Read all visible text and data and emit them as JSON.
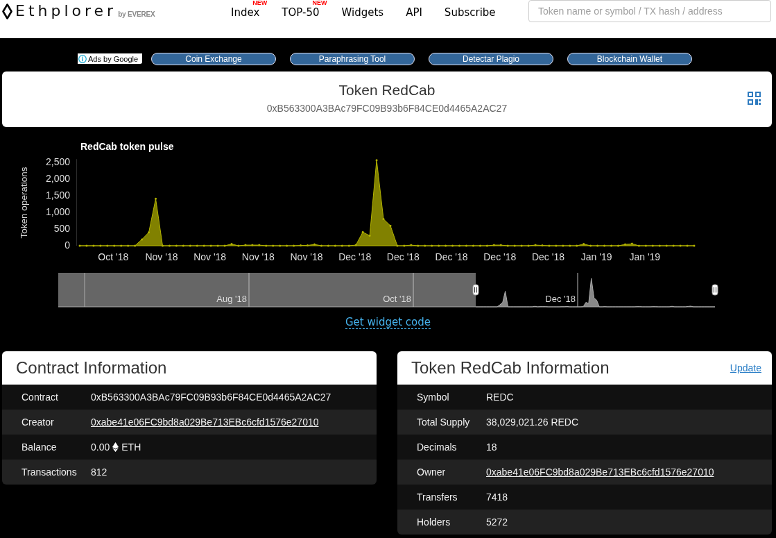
{
  "header": {
    "logo": {
      "wordmark": "Ethplorer",
      "byline": "by EVEREX"
    },
    "nav": [
      {
        "label": "Index",
        "badge": "NEW"
      },
      {
        "label": "TOP-50",
        "badge": "NEW"
      },
      {
        "label": "Widgets"
      },
      {
        "label": "API"
      },
      {
        "label": "Subscribe"
      }
    ],
    "search": {
      "placeholder": "Token name or symbol / TX hash / address"
    }
  },
  "ads": {
    "label": "Ads by Google",
    "links": [
      "Coin Exchange",
      "Paraphrasing Tool",
      "Detectar Plagio",
      "Blockchain Wallet"
    ]
  },
  "token_card": {
    "title": "Token RedCab",
    "address": "0xB563300A3BAc79FC09B93b6F84CE0d4465A2AC27"
  },
  "chart": {
    "chart_data": {
      "type": "area",
      "title": "RedCab token pulse",
      "ylabel": "Token operations",
      "categories": [
        null,
        null,
        null,
        null,
        null,
        "Oct '18",
        null,
        null,
        null,
        null,
        null,
        null,
        "Nov '18",
        null,
        null,
        null,
        null,
        null,
        null,
        "Nov '18",
        null,
        null,
        null,
        null,
        null,
        null,
        "Nov '18",
        null,
        null,
        null,
        null,
        null,
        null,
        "Nov '18",
        null,
        null,
        null,
        null,
        null,
        null,
        "Dec '18",
        null,
        null,
        null,
        null,
        null,
        null,
        "Dec '18",
        null,
        null,
        null,
        null,
        null,
        null,
        "Dec '18",
        null,
        null,
        null,
        null,
        null,
        null,
        "Dec '18",
        null,
        null,
        null,
        null,
        null,
        null,
        "Dec '18",
        null,
        null,
        null,
        null,
        null,
        null,
        "Jan '19",
        null,
        null,
        null,
        null,
        null,
        null,
        "Jan '19",
        null,
        null,
        null,
        null,
        null,
        null,
        null
      ],
      "series": [
        {
          "color": "#b3b300",
          "values": [
            0,
            0,
            0,
            0,
            0,
            0,
            0,
            0,
            0,
            190,
            400,
            1410,
            0,
            0,
            0,
            0,
            0,
            0,
            0,
            0,
            0,
            0,
            50,
            0,
            20,
            20,
            20,
            0,
            0,
            0,
            0,
            0,
            10,
            10,
            40,
            0,
            0,
            0,
            0,
            0,
            20,
            410,
            300,
            2570,
            800,
            600,
            0,
            0,
            20,
            0,
            0,
            0,
            0,
            0,
            0,
            0,
            0,
            0,
            0,
            0,
            20,
            20,
            0,
            0,
            0,
            0,
            20,
            10,
            0,
            0,
            0,
            0,
            0,
            50,
            0,
            0,
            0,
            0,
            0,
            40,
            60,
            0,
            0,
            0,
            0,
            0,
            0,
            0,
            0,
            0
          ]
        }
      ],
      "ylim": [
        0,
        2600
      ],
      "yticks": [
        {
          "value": 0,
          "label": "0"
        },
        {
          "value": 500,
          "label": "500"
        },
        {
          "value": 1000,
          "label": "1,000"
        },
        {
          "value": 1500,
          "label": "1,500"
        },
        {
          "value": 2000,
          "label": "2,000"
        },
        {
          "value": 2500,
          "label": "2,500"
        }
      ]
    },
    "navigator": {
      "labels": [
        "Aug '18",
        "Oct '18",
        "Dec '18"
      ]
    },
    "widget_link": "Get widget code"
  },
  "contract_panel": {
    "title": "Contract Information",
    "rows": [
      {
        "kind": "text",
        "label": "Contract",
        "value": "0xB563300A3BAc79FC09B93b6F84CE0d4465A2AC27"
      },
      {
        "kind": "link",
        "label": "Creator",
        "value": "0xabe41e06FC9bd8a029Be713EBc6cfd1576e27010"
      },
      {
        "kind": "balance",
        "label": "Balance",
        "value": "0.00",
        "unit": "ETH"
      },
      {
        "kind": "text",
        "label": "Transactions",
        "value": "812"
      }
    ]
  },
  "token_panel": {
    "title": "Token RedCab Information",
    "action": "Update",
    "rows": [
      {
        "kind": "text",
        "label": "Symbol",
        "value": "REDC"
      },
      {
        "kind": "text",
        "label": "Total Supply",
        "value": "38,029,021.26 REDC"
      },
      {
        "kind": "text",
        "label": "Decimals",
        "value": "18"
      },
      {
        "kind": "link",
        "label": "Owner",
        "value": "0xabe41e06FC9bd8a029Be713EBc6cfd1576e27010"
      },
      {
        "kind": "text",
        "label": "Transfers",
        "value": "7418"
      },
      {
        "kind": "text",
        "label": "Holders",
        "value": "5272"
      }
    ]
  }
}
